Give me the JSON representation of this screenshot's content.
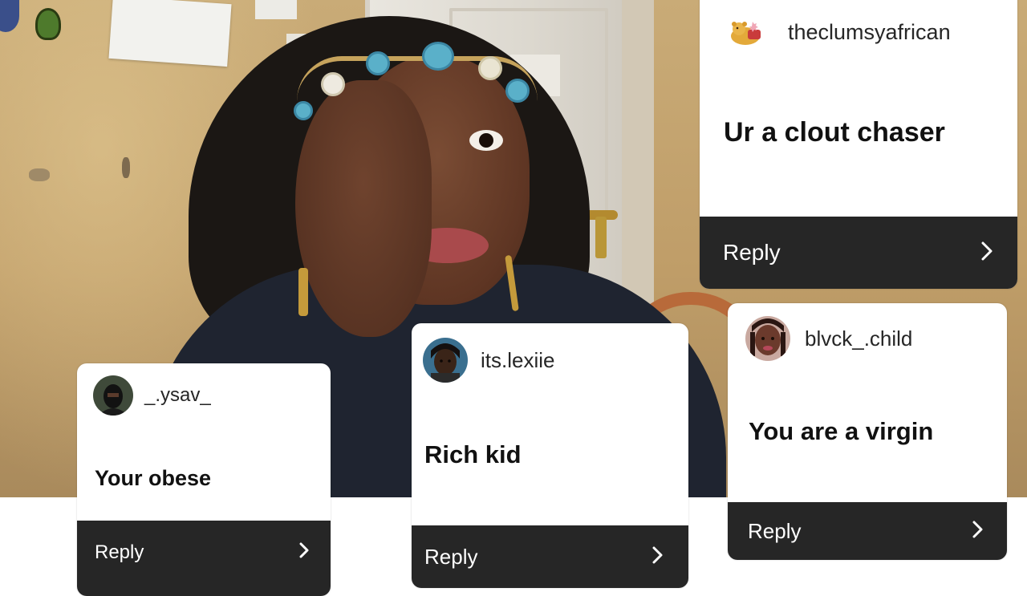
{
  "comments": [
    {
      "username": "theclumsyafrican",
      "message": "Ur a clout chaser",
      "reply_label": "Reply",
      "avatar_icon": "winnie-the-pooh-icon"
    },
    {
      "username": "blvck_.child",
      "message": "You are a virgin",
      "reply_label": "Reply",
      "avatar_icon": "profile-photo-avatar"
    },
    {
      "username": "its.lexiie",
      "message": "Rich kid",
      "reply_label": "Reply",
      "avatar_icon": "profile-photo-avatar"
    },
    {
      "username": "_.ysav_",
      "message": "Your obese",
      "reply_label": "Reply",
      "avatar_icon": "profile-photo-avatar"
    }
  ],
  "icons": {
    "reply_arrow": "chevron-right-icon"
  },
  "colors": {
    "card_background": "#ffffff",
    "reply_bar": "#262626",
    "reply_text": "#ffffff",
    "message_text": "#111111",
    "username_text": "#262626"
  }
}
